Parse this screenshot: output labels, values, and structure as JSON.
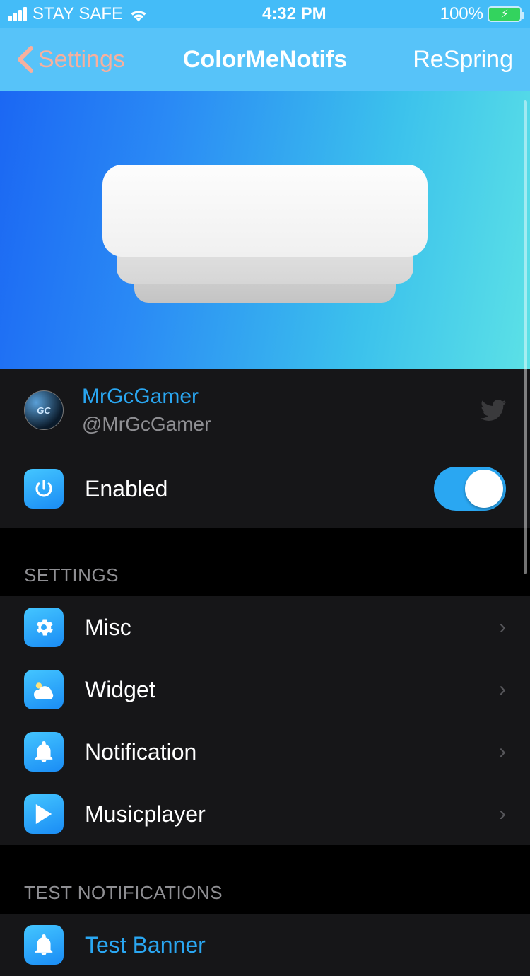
{
  "status": {
    "carrier": "STAY SAFE",
    "time": "4:32 PM",
    "battery_pct": "100%"
  },
  "nav": {
    "back": "Settings",
    "title": "ColorMeNotifs",
    "action": "ReSpring"
  },
  "developer": {
    "name": "MrGcGamer",
    "handle": "@MrGcGamer",
    "avatar_text": "GC"
  },
  "enabled": {
    "label": "Enabled",
    "value": true
  },
  "sections": [
    {
      "header": "SETTINGS",
      "rows": [
        {
          "icon": "gears-icon",
          "label": "Misc"
        },
        {
          "icon": "weather-icon",
          "label": "Widget"
        },
        {
          "icon": "bell-icon",
          "label": "Notification"
        },
        {
          "icon": "play-icon",
          "label": "Musicplayer"
        }
      ]
    },
    {
      "header": "TEST NOTIFICATIONS",
      "rows": [
        {
          "icon": "bell-icon",
          "label": "Test Banner",
          "accent": true
        }
      ]
    }
  ]
}
